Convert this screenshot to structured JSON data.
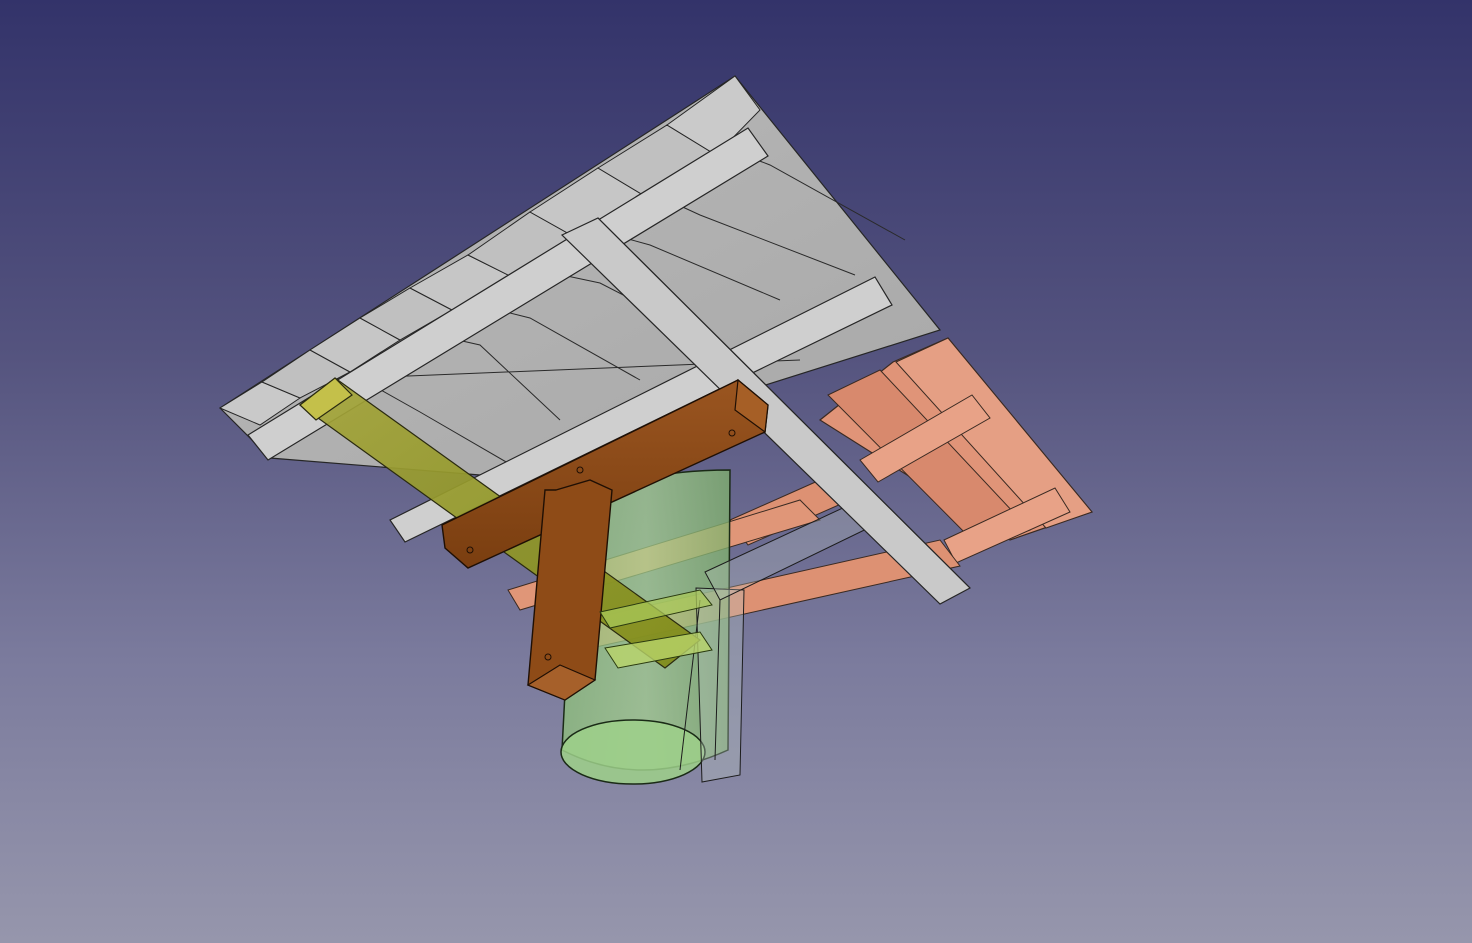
{
  "viewport": {
    "background_top": "#33336a",
    "background_bottom": "#9696ac"
  },
  "scene": {
    "description_visible_text": "",
    "parts": [
      {
        "name": "deck-top-boards",
        "color": "#b8b8b8"
      },
      {
        "name": "deck-joists",
        "color": "#bdbdbd"
      },
      {
        "name": "deck-long-beam",
        "color": "#c4c4c4"
      },
      {
        "name": "sloped-boards",
        "color": "#e0957a"
      },
      {
        "name": "sloped-joists",
        "color": "#dd8a6a"
      },
      {
        "name": "yellow-beam",
        "color": "#9ea33a"
      },
      {
        "name": "brown-bracket",
        "color": "#8a4a1a"
      },
      {
        "name": "green-cylinder",
        "color": "#88c27a"
      },
      {
        "name": "transparent-channel",
        "color": "#a8c0b8"
      }
    ]
  }
}
